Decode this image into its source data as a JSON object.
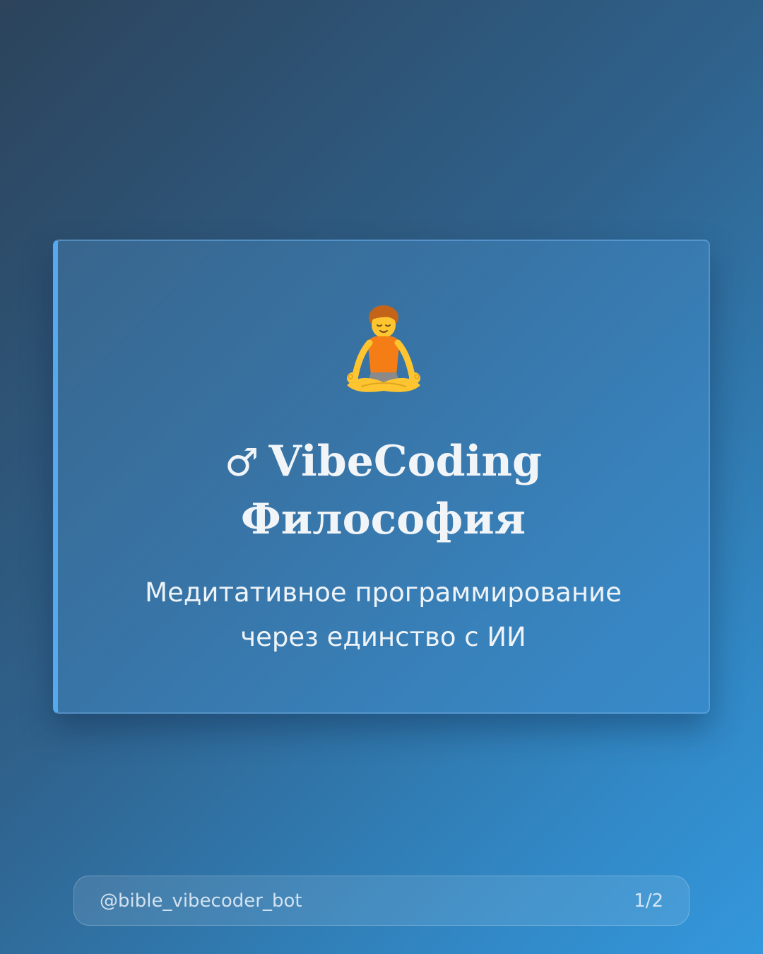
{
  "card": {
    "icon": "person-in-lotus-position-icon",
    "title_prefix": "♂",
    "title_line1": "VibeCoding",
    "title_line2": "Философия",
    "subtitle_line1": "Медитативное программирование",
    "subtitle_line2": "через единство с ИИ"
  },
  "footer": {
    "handle": "@bible_vibecoder_bot",
    "page_indicator": "1/2"
  },
  "colors": {
    "background_start": "#2c435b",
    "background_end": "#3497dc",
    "card_accent": "#56a9ec",
    "text": "#f2f5f8"
  }
}
